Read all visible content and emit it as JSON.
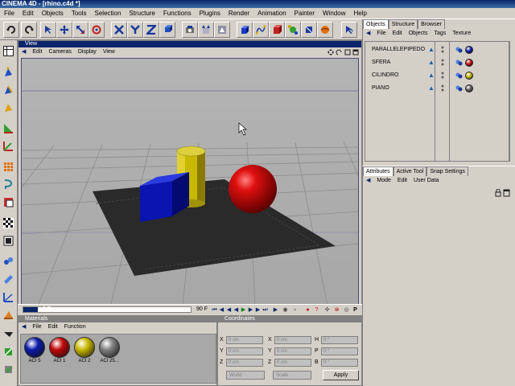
{
  "window": {
    "title": "CINEMA 4D - [rhino.c4d *]"
  },
  "menu": [
    "File",
    "Edit",
    "Objects",
    "Tools",
    "Selection",
    "Structure",
    "Functions",
    "Plugins",
    "Render",
    "Animation",
    "Painter",
    "Window",
    "Help"
  ],
  "toolbar_icons": [
    "undo-icon",
    "redo-icon",
    "select-icon",
    "move-icon",
    "scale-icon",
    "rotate-icon",
    "x-axis-icon",
    "y-axis-icon",
    "z-axis-icon",
    "world-axis-icon",
    "camera-icon",
    "render-region-icon",
    "render-icon",
    "cube-icon",
    "spline-icon",
    "nurbs-icon",
    "array-icon",
    "deformer-icon",
    "scene-icon",
    "light-icon",
    "help-icon"
  ],
  "left_tools": [
    "layout-icon",
    "points-icon",
    "edges-icon",
    "polygons-icon",
    "texture-icon",
    "object-axis-icon",
    "model-icon",
    "grid-icon",
    "checker-icon",
    "animation-icon",
    "bone-icon",
    "paint-icon",
    "surface-icon",
    "camera-tool-icon",
    "key-icon"
  ],
  "view": {
    "title": "View",
    "menu": [
      "Edit",
      "Cameras",
      "Display",
      "View"
    ]
  },
  "timeline": {
    "current_frame": "0 F",
    "end_frame": "90 F",
    "progress": 0.0
  },
  "materials": {
    "title": "Materials",
    "menu": [
      "File",
      "Edit",
      "Function"
    ],
    "items": [
      {
        "label": "ACI 5",
        "color": "#0a1aa8"
      },
      {
        "label": "ACI 1",
        "color": "#c00808"
      },
      {
        "label": "ACI 2",
        "color": "#c8b800"
      },
      {
        "label": "ACI 25...",
        "color": "#808080"
      }
    ]
  },
  "coordinates": {
    "title": "Coordinates",
    "rows": [
      {
        "a": "X",
        "av": "0 cm",
        "b": "X",
        "bv": "0 cm",
        "c": "H",
        "cv": "0 °"
      },
      {
        "a": "Y",
        "av": "0 cm",
        "b": "Y",
        "bv": "0 cm",
        "c": "P",
        "cv": "0 °"
      },
      {
        "a": "Z",
        "av": "0 cm",
        "b": "Z",
        "bv": "0 cm",
        "c": "B",
        "cv": "0 °"
      }
    ],
    "mode": "World",
    "scale": "Scale",
    "apply": "Apply"
  },
  "objects": {
    "tabs": [
      "Objects",
      "Structure",
      "Browser"
    ],
    "menu": [
      "File",
      "Edit",
      "Objects",
      "Tags",
      "Texture"
    ],
    "items": [
      {
        "name": "PARALLELEPIPEDO",
        "color": "#0a1aa8"
      },
      {
        "name": "SFERA",
        "color": "#c00808"
      },
      {
        "name": "CILINDRO",
        "color": "#c8b800"
      },
      {
        "name": "PIANO",
        "color": "#606060"
      }
    ]
  },
  "attributes": {
    "tabs": [
      "Attributes",
      "Active Tool",
      "Snap Settings"
    ],
    "menu": [
      "Mode",
      "Edit",
      "User Data"
    ]
  },
  "colors": {
    "title_active": "#0a246a",
    "ui_gray": "#d4d0c8",
    "viewport_bg": "#aeaeae",
    "floor": "#2a2a2a"
  }
}
